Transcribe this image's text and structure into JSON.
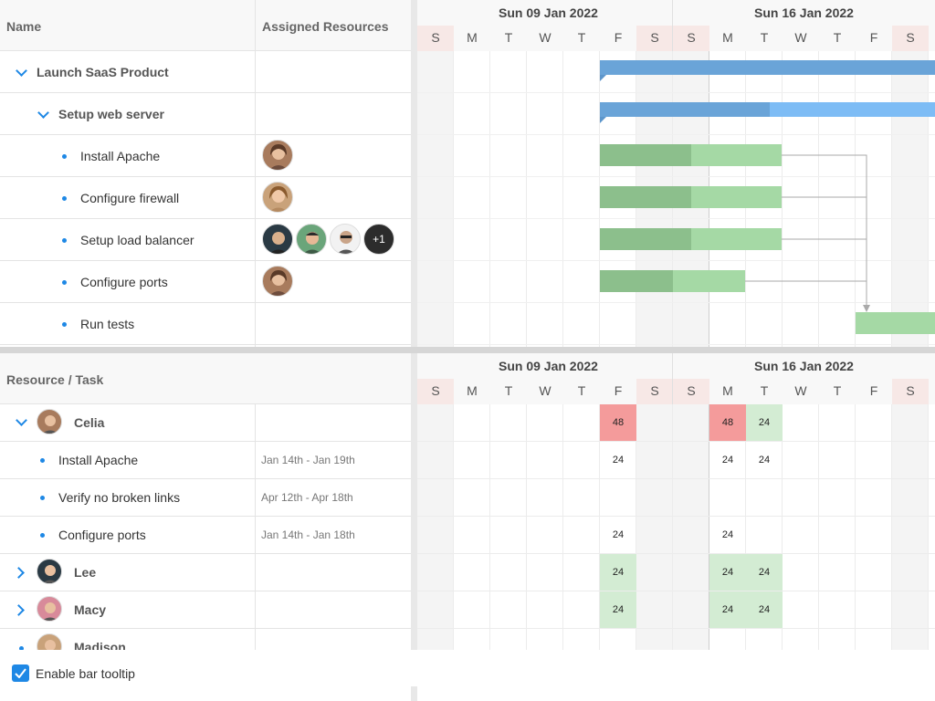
{
  "top_grid": {
    "col_name": "Name",
    "col_resources": "Assigned Resources",
    "weeks": [
      "Sun 09 Jan 2022",
      "Sun 16 Jan 2022"
    ],
    "days": [
      "S",
      "M",
      "T",
      "W",
      "T",
      "F",
      "S",
      "S",
      "M",
      "T",
      "W",
      "T",
      "F",
      "S"
    ],
    "rows": [
      {
        "name": "Launch SaaS Product"
      },
      {
        "name": "Setup web server"
      },
      {
        "name": "Install Apache"
      },
      {
        "name": "Configure firewall"
      },
      {
        "name": "Setup load balancer",
        "extra_count": "+1"
      },
      {
        "name": "Configure ports"
      },
      {
        "name": "Run tests"
      }
    ]
  },
  "bottom_grid": {
    "col_resource": "Resource / Task",
    "weeks": [
      "Sun 09 Jan 2022",
      "Sun 16 Jan 2022"
    ],
    "days": [
      "S",
      "M",
      "T",
      "W",
      "T",
      "F",
      "S",
      "S",
      "M",
      "T",
      "W",
      "T",
      "F",
      "S"
    ],
    "rows": [
      {
        "name": "Celia",
        "dates": "",
        "cells": {
          "5": "48",
          "8": "48",
          "9": "24"
        }
      },
      {
        "name": "Install Apache",
        "dates": "Jan 14th - Jan 19th",
        "cells": {
          "5": "24",
          "8": "24",
          "9": "24"
        }
      },
      {
        "name": "Verify no broken links",
        "dates": "Apr 12th - Apr 18th",
        "cells": {}
      },
      {
        "name": "Configure ports",
        "dates": "Jan 14th - Jan 18th",
        "cells": {
          "5": "24",
          "8": "24"
        }
      },
      {
        "name": "Lee",
        "dates": "",
        "cells": {
          "5": "24",
          "8": "24",
          "9": "24"
        }
      },
      {
        "name": "Macy",
        "dates": "",
        "cells": {
          "5": "24",
          "8": "24",
          "9": "24"
        }
      },
      {
        "name": "Madison",
        "dates": "",
        "cells": {}
      }
    ]
  },
  "footer": {
    "tooltip_label": "Enable bar tooltip",
    "tooltip_checked": true
  },
  "colors": {
    "accent": "#1e88e5",
    "overload": "#f49b9b",
    "normal": "#d3ecd3",
    "bar_blue": "#6aa4d8",
    "bar_green": "#a5d9a5"
  }
}
